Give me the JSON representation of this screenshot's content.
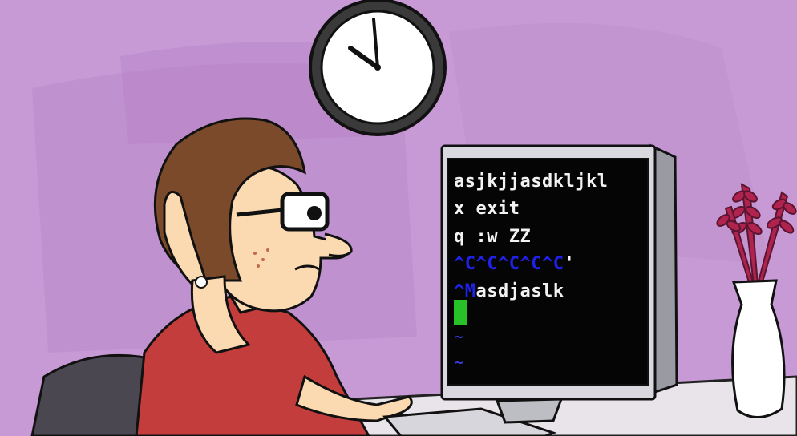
{
  "colors": {
    "wall": "#c79ad6",
    "wall_shape": "#b98ac9",
    "terminal_bg": "#050505",
    "terminal_text": "#f2f2f2",
    "terminal_ctrl_blue": "#1f22e6",
    "cursor_green": "#27c227",
    "shirt_red": "#c33d3d",
    "hair_brown": "#7a4a2a"
  },
  "terminal": {
    "line1": "asjkjjasdkljkl",
    "line2": "x exit",
    "line3": "q :w ZZ",
    "line4_ctrl": "^C^C^C^C^C",
    "line4_tail": "'",
    "line5_ctrl": "^M",
    "line5_tail": "asdjaslk",
    "tilde": "~"
  },
  "icons": [
    "wall-clock-icon",
    "vase-with-plant-icon",
    "computer-monitor-icon",
    "keyboard-icon"
  ]
}
